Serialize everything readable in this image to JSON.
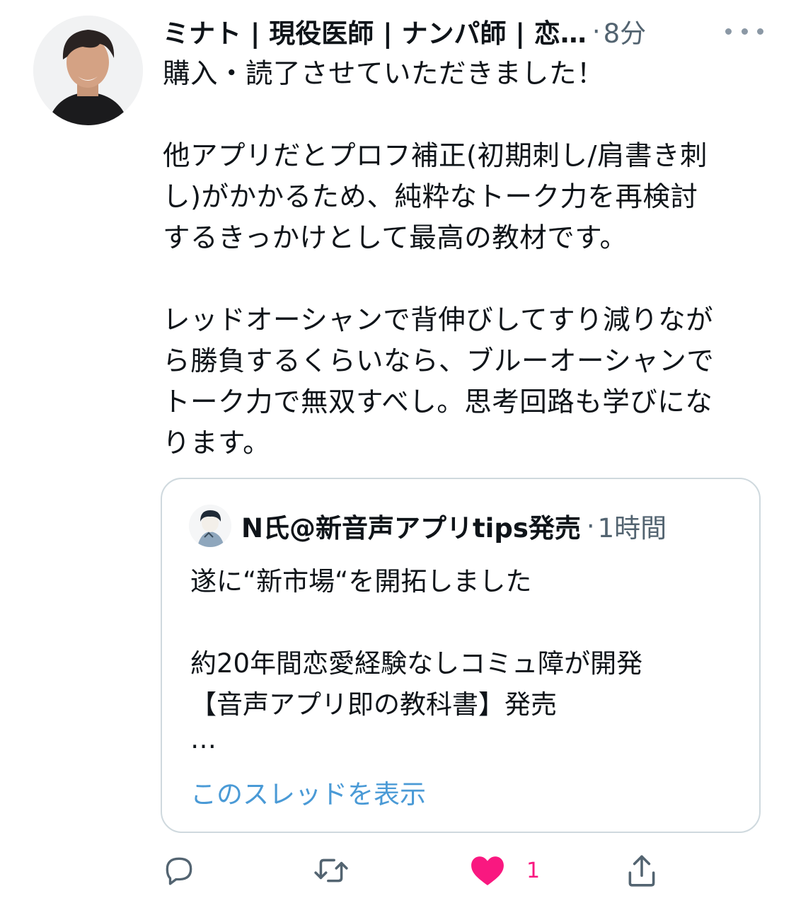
{
  "tweet": {
    "author_name": "ミナト | 現役医師 | ナンパ師 | 恋…",
    "separator": "·",
    "timestamp": "8分",
    "lines": [
      "購入・読了させていただきました！",
      "",
      "他アプリだとプロフ補正(初期刺し/肩書き刺",
      "し)がかかるため、純粋なトーク力を再検討",
      "するきっかけとして最高の教材です。",
      "",
      "レッドオーシャンで背伸びしてすり減りなが",
      "ら勝負するくらいなら、ブルーオーシャンで",
      "トーク力で無双すべし。思考回路も学びにな",
      "ります。"
    ]
  },
  "quote": {
    "author_name": "N氏@新音声アプリtips発売",
    "separator": "·",
    "timestamp": "1時間",
    "lines": [
      "遂に“新市場“を開拓しました",
      "",
      "約20年間恋愛経験なしコミュ障が開発",
      "【音声アプリ即の教科書】発売",
      "…"
    ],
    "show_thread_label": "このスレッドを表示"
  },
  "actions": {
    "reply_icon": "reply-icon",
    "retweet_icon": "retweet-icon",
    "like_icon": "heart-icon",
    "like_count": "1",
    "share_icon": "share-icon"
  },
  "colors": {
    "text": "#0f1419",
    "secondary": "#536471",
    "link": "#4a9ad6",
    "like": "#f91880",
    "icon": "#536471",
    "border": "#cfd9de"
  }
}
